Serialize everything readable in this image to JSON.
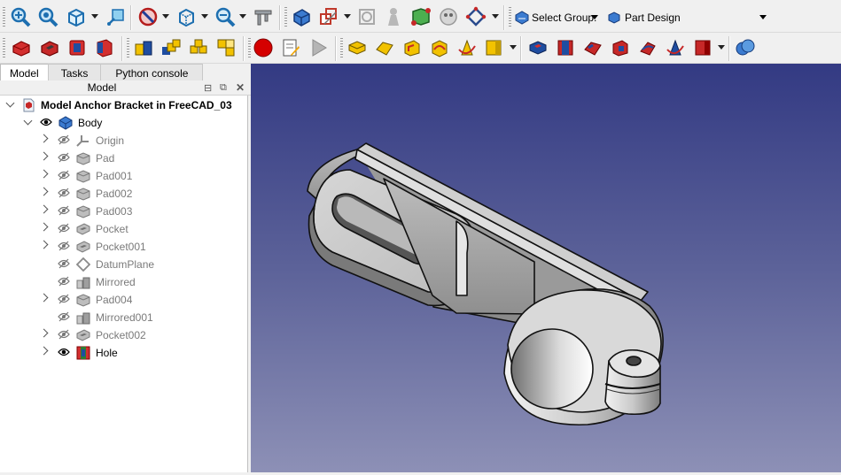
{
  "toolbar1": {
    "select_group_label": "Select Group:",
    "workbench_label": "Part Design",
    "icons": [
      "zoom-all-icon",
      "zoom-selection-icon",
      "view-cube-icon",
      "view-pick-icon",
      "draw-style-icon",
      "bounding-box-icon",
      "measure-zoom-icon",
      "measure-caliper-icon",
      "create-body-icon",
      "create-sketch-icon",
      "validate-sketch-icon",
      "shape-binder-icon",
      "sub-shape-binder-icon",
      "clone-icon",
      "datum-plane-icon",
      "select-group-icon",
      "part-design-icon"
    ]
  },
  "toolbar2": {
    "icons": [
      "pad-icon",
      "pocket-icon",
      "revolution-icon",
      "groove-icon",
      "mirrored-icon",
      "linear-pattern-icon",
      "polar-pattern-icon",
      "multitransform-icon",
      "macro-record-icon",
      "macro-edit-icon",
      "macro-run-icon",
      "additive-box-icon",
      "additive-loft-icon",
      "additive-pipe-icon",
      "additive-helix-icon",
      "additive-primitive-icon",
      "subtractive-box-icon",
      "hole-icon",
      "subtractive-loft-icon",
      "subtractive-pipe-icon",
      "subtractive-helix-icon",
      "subtractive-primitive-icon",
      "boolean-icon"
    ]
  },
  "tabs": [
    {
      "label": "Model",
      "active": true
    },
    {
      "label": "Tasks",
      "active": false
    },
    {
      "label": "Python console",
      "active": false
    }
  ],
  "panel": {
    "title": "Model"
  },
  "tree": {
    "root": "Model Anchor Bracket in FreeCAD_03",
    "body": "Body",
    "items": [
      {
        "label": "Origin",
        "icon": "origin-icon",
        "expandable": true,
        "visible": false
      },
      {
        "label": "Pad",
        "icon": "pad-icon",
        "expandable": true,
        "visible": false
      },
      {
        "label": "Pad001",
        "icon": "pad-icon",
        "expandable": true,
        "visible": false
      },
      {
        "label": "Pad002",
        "icon": "pad-icon",
        "expandable": true,
        "visible": false
      },
      {
        "label": "Pad003",
        "icon": "pad-icon",
        "expandable": true,
        "visible": false
      },
      {
        "label": "Pocket",
        "icon": "pocket-icon",
        "expandable": true,
        "visible": false
      },
      {
        "label": "Pocket001",
        "icon": "pocket-icon",
        "expandable": true,
        "visible": false
      },
      {
        "label": "DatumPlane",
        "icon": "datum-plane-icon",
        "expandable": false,
        "visible": false
      },
      {
        "label": "Mirrored",
        "icon": "mirrored-icon",
        "expandable": false,
        "visible": false
      },
      {
        "label": "Pad004",
        "icon": "pad-icon",
        "expandable": true,
        "visible": false
      },
      {
        "label": "Mirrored001",
        "icon": "mirrored-icon",
        "expandable": false,
        "visible": false
      },
      {
        "label": "Pocket002",
        "icon": "pocket-icon",
        "expandable": true,
        "visible": false
      },
      {
        "label": "Hole",
        "icon": "hole-icon",
        "expandable": true,
        "visible": true
      }
    ]
  },
  "viewport": {
    "model": "anchor-bracket-3d-model",
    "background_top": "#333a83",
    "background_bottom": "#8d90b6"
  }
}
